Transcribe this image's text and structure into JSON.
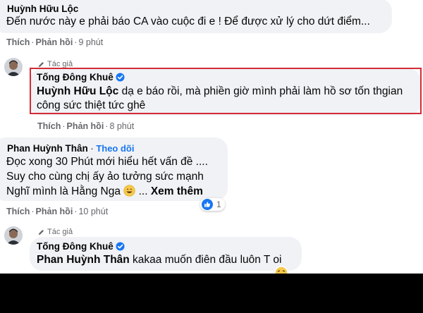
{
  "comment1": {
    "author": "Huỳnh Hữu Lộc",
    "text": "Đến nước này e phải báo CA vào cuộc đi e ! Để được xử lý cho dứt điểm...",
    "like": "Thích",
    "reply": "Phản hồi",
    "time": "9 phút"
  },
  "reply1": {
    "badge": "Tác giả",
    "author": "Tống Đông Khuê",
    "tag": "Huỳnh Hữu Lộc",
    "line1": " dạ e báo rồi, mà phiền giờ mình phải làm hồ sơ tốn thgian",
    "line2": "công sức thiệt tức ghê",
    "like": "Thích",
    "reply": "Phản hồi",
    "time": "8 phút"
  },
  "comment2": {
    "author": "Phan Huỳnh Thân",
    "follow": "Theo dõi",
    "line1": "Đọc xong 30 Phút mới hiểu hết vấn đề ....",
    "line2": "Suy cho cùng chị ấy ảo tưởng sức mạnh",
    "line3": "Nghĩ mình là Hằng Nga",
    "ellipsis": "...",
    "see_more": "Xem thêm",
    "reaction_count": "1",
    "like": "Thích",
    "reply": "Phản hồi",
    "time": "10 phút"
  },
  "reply2": {
    "badge": "Tác giả",
    "author": "Tống Đông Khuê",
    "tag": "Phan Huỳnh Thân",
    "text": " kakaa muốn điên đầu luôn T oi"
  },
  "colors": {
    "bubble": "#f0f2f5",
    "highlight": "#d32b36",
    "link": "#1877f2",
    "meta": "#65676b"
  }
}
